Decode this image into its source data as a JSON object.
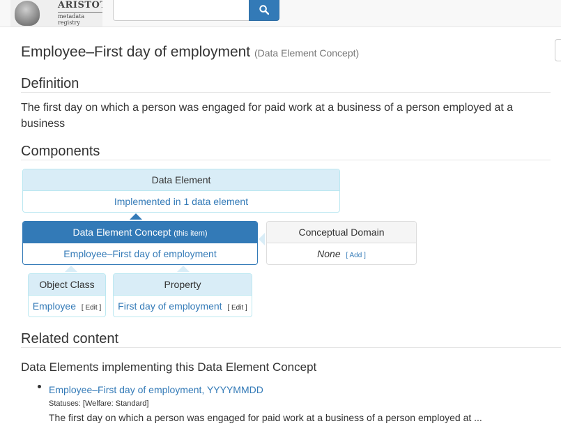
{
  "navbar": {
    "brand": "ARISTOTLE",
    "brand_sub": "metadata registry",
    "search_placeholder": "",
    "search_icon": "search-icon"
  },
  "page": {
    "title": "Employee–First day of employment",
    "type_label": "(Data Element Concept)"
  },
  "definition": {
    "heading": "Definition",
    "text": "The first day on which a person was engaged for paid work at a business of a person employed at a business"
  },
  "components": {
    "heading": "Components",
    "data_element": {
      "header": "Data Element",
      "body": "Implemented in 1 data element"
    },
    "dec": {
      "header": "Data Element Concept",
      "header_note": "(this item)",
      "body": "Employee–First day of employment"
    },
    "conceptual_domain": {
      "header": "Conceptual Domain",
      "value": "None",
      "action": "[ Add ]"
    },
    "object_class": {
      "header": "Object Class",
      "value": "Employee",
      "action": "[ Edit ]"
    },
    "property": {
      "header": "Property",
      "value": "First day of employment",
      "action": "[ Edit ]"
    }
  },
  "related": {
    "heading": "Related content",
    "subheading": "Data Elements implementing this Data Element Concept",
    "items": [
      {
        "link": "Employee–First day of employment, YYYYMMDD",
        "statuses": "Statuses: [Welfare: Standard]",
        "summary": "The first day on which a person was engaged for paid work at a business of a person employed at ..."
      }
    ]
  },
  "colors": {
    "primary": "#337ab7",
    "info_bg": "#d9edf7",
    "info_border": "#bce8f1"
  }
}
